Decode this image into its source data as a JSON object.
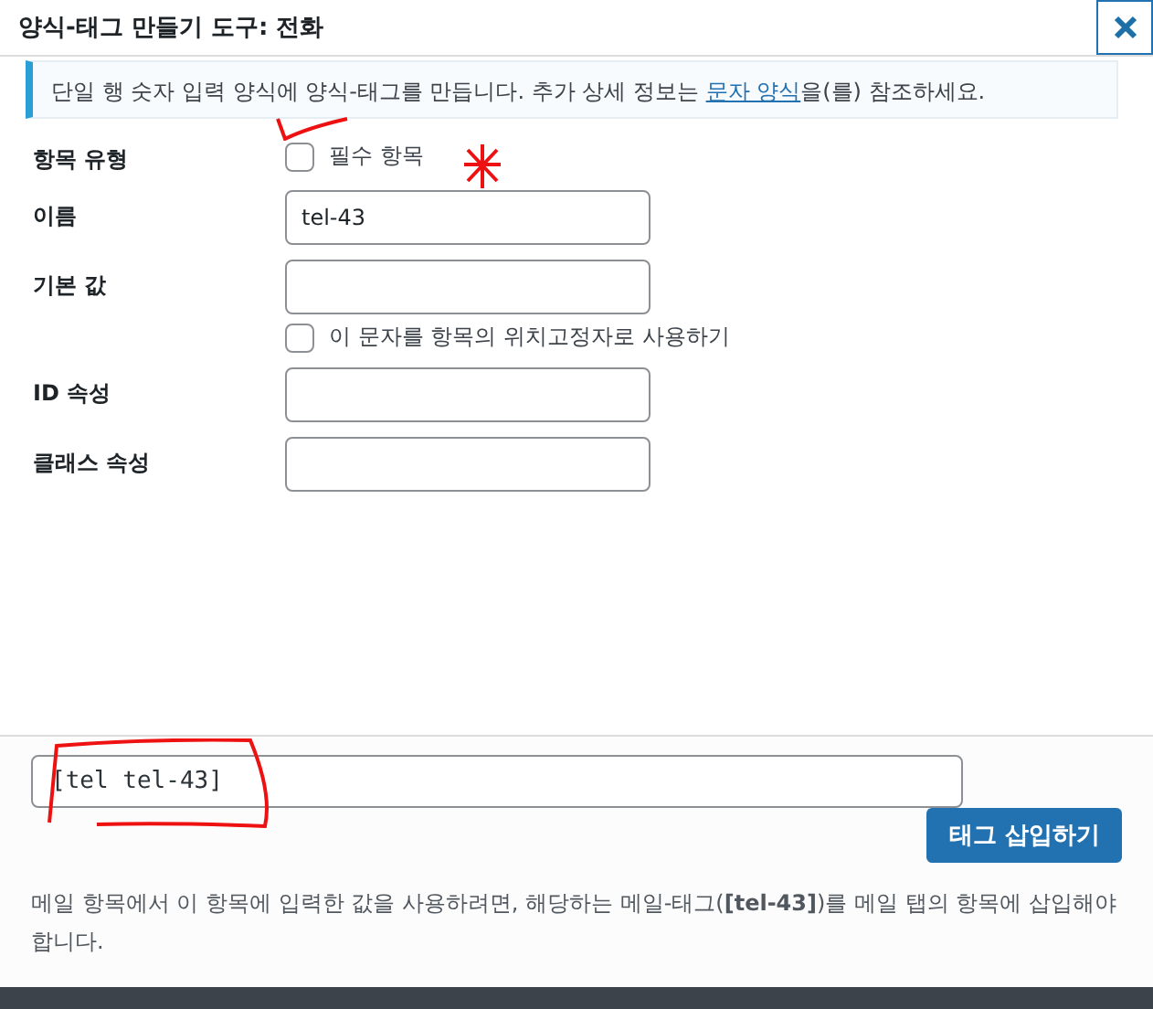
{
  "dialog": {
    "title": "양식-태그 만들기 도구: 전화"
  },
  "notice": {
    "before": "단일 행 숫자 입력 양식에 양식-태그를 만듭니다. 추가 상세 정보는 ",
    "link": "문자 양식",
    "after": "을(를) 참조하세요."
  },
  "fields": [
    {
      "kind": "checkbox",
      "label": "항목 유형",
      "option": "필수 항목",
      "checked": false
    },
    {
      "kind": "text",
      "label": "이름",
      "value": "tel-43"
    },
    {
      "kind": "text",
      "label": "기본 값",
      "option": "이 문자를 항목의 위치고정자로 사용하기",
      "checked": false
    },
    {
      "kind": "text",
      "label": "ID 속성"
    },
    {
      "kind": "text",
      "label": "클래스 속성"
    }
  ],
  "tag_field": {
    "value": "[tel tel-43]"
  },
  "insert_button": "태그 삽입하기",
  "hint": "메일 항목에서 이 항목에 입력한 값을 사용하려면, 해당하는 메일-태그(**[tel-43]**)를 메일 탭의 항목에 삽입해야 합니다."
}
